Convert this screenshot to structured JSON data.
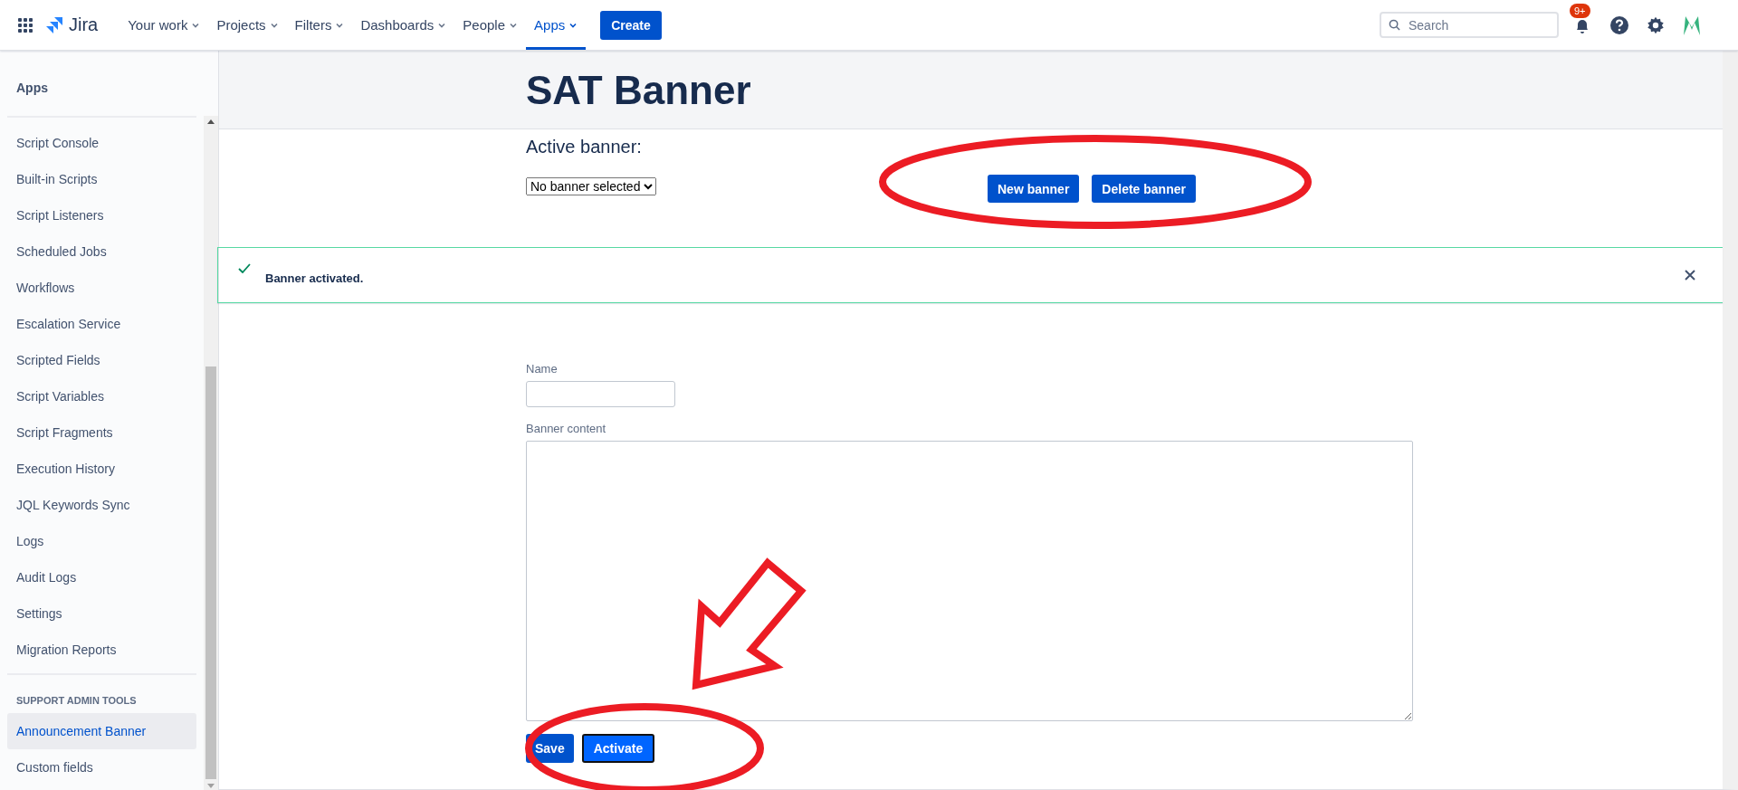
{
  "topbar": {
    "product": "Jira",
    "nav": [
      {
        "label": "Your work",
        "selected": false
      },
      {
        "label": "Projects",
        "selected": false
      },
      {
        "label": "Filters",
        "selected": false
      },
      {
        "label": "Dashboards",
        "selected": false
      },
      {
        "label": "People",
        "selected": false
      },
      {
        "label": "Apps",
        "selected": true
      }
    ],
    "create": "Create",
    "search": {
      "placeholder": "Search"
    },
    "notifications_badge": "9+"
  },
  "sidebar": {
    "title": "Apps",
    "sections": [
      {
        "items": [
          {
            "label": "Script Console",
            "selected": false
          },
          {
            "label": "Built-in Scripts",
            "selected": false
          },
          {
            "label": "Script Listeners",
            "selected": false
          },
          {
            "label": "Scheduled Jobs",
            "selected": false
          },
          {
            "label": "Workflows",
            "selected": false
          },
          {
            "label": "Escalation Service",
            "selected": false
          },
          {
            "label": "Scripted Fields",
            "selected": false
          },
          {
            "label": "Script Variables",
            "selected": false
          },
          {
            "label": "Script Fragments",
            "selected": false
          },
          {
            "label": "Execution History",
            "selected": false
          },
          {
            "label": "JQL Keywords Sync",
            "selected": false
          },
          {
            "label": "Logs",
            "selected": false
          },
          {
            "label": "Audit Logs",
            "selected": false
          },
          {
            "label": "Settings",
            "selected": false
          },
          {
            "label": "Migration Reports",
            "selected": false
          }
        ]
      },
      {
        "heading": "SUPPORT ADMIN TOOLS",
        "items": [
          {
            "label": "Announcement Banner",
            "selected": true
          },
          {
            "label": "Custom fields",
            "selected": false
          }
        ]
      }
    ]
  },
  "page": {
    "title": "SAT Banner",
    "active_banner_label": "Active banner:",
    "active_banner_select": "No banner selected",
    "buttons": [
      "New banner",
      "Delete banner"
    ],
    "message": {
      "text": "Banner activated."
    },
    "form": {
      "name_label": "Name",
      "content_label": "Banner content",
      "buttons": [
        {
          "label": "Save",
          "focused": false
        },
        {
          "label": "Activate",
          "focused": true
        }
      ]
    }
  },
  "annotations": [
    {
      "kind": "ellipse"
    },
    {
      "kind": "arrow"
    },
    {
      "kind": "ellipse"
    }
  ]
}
